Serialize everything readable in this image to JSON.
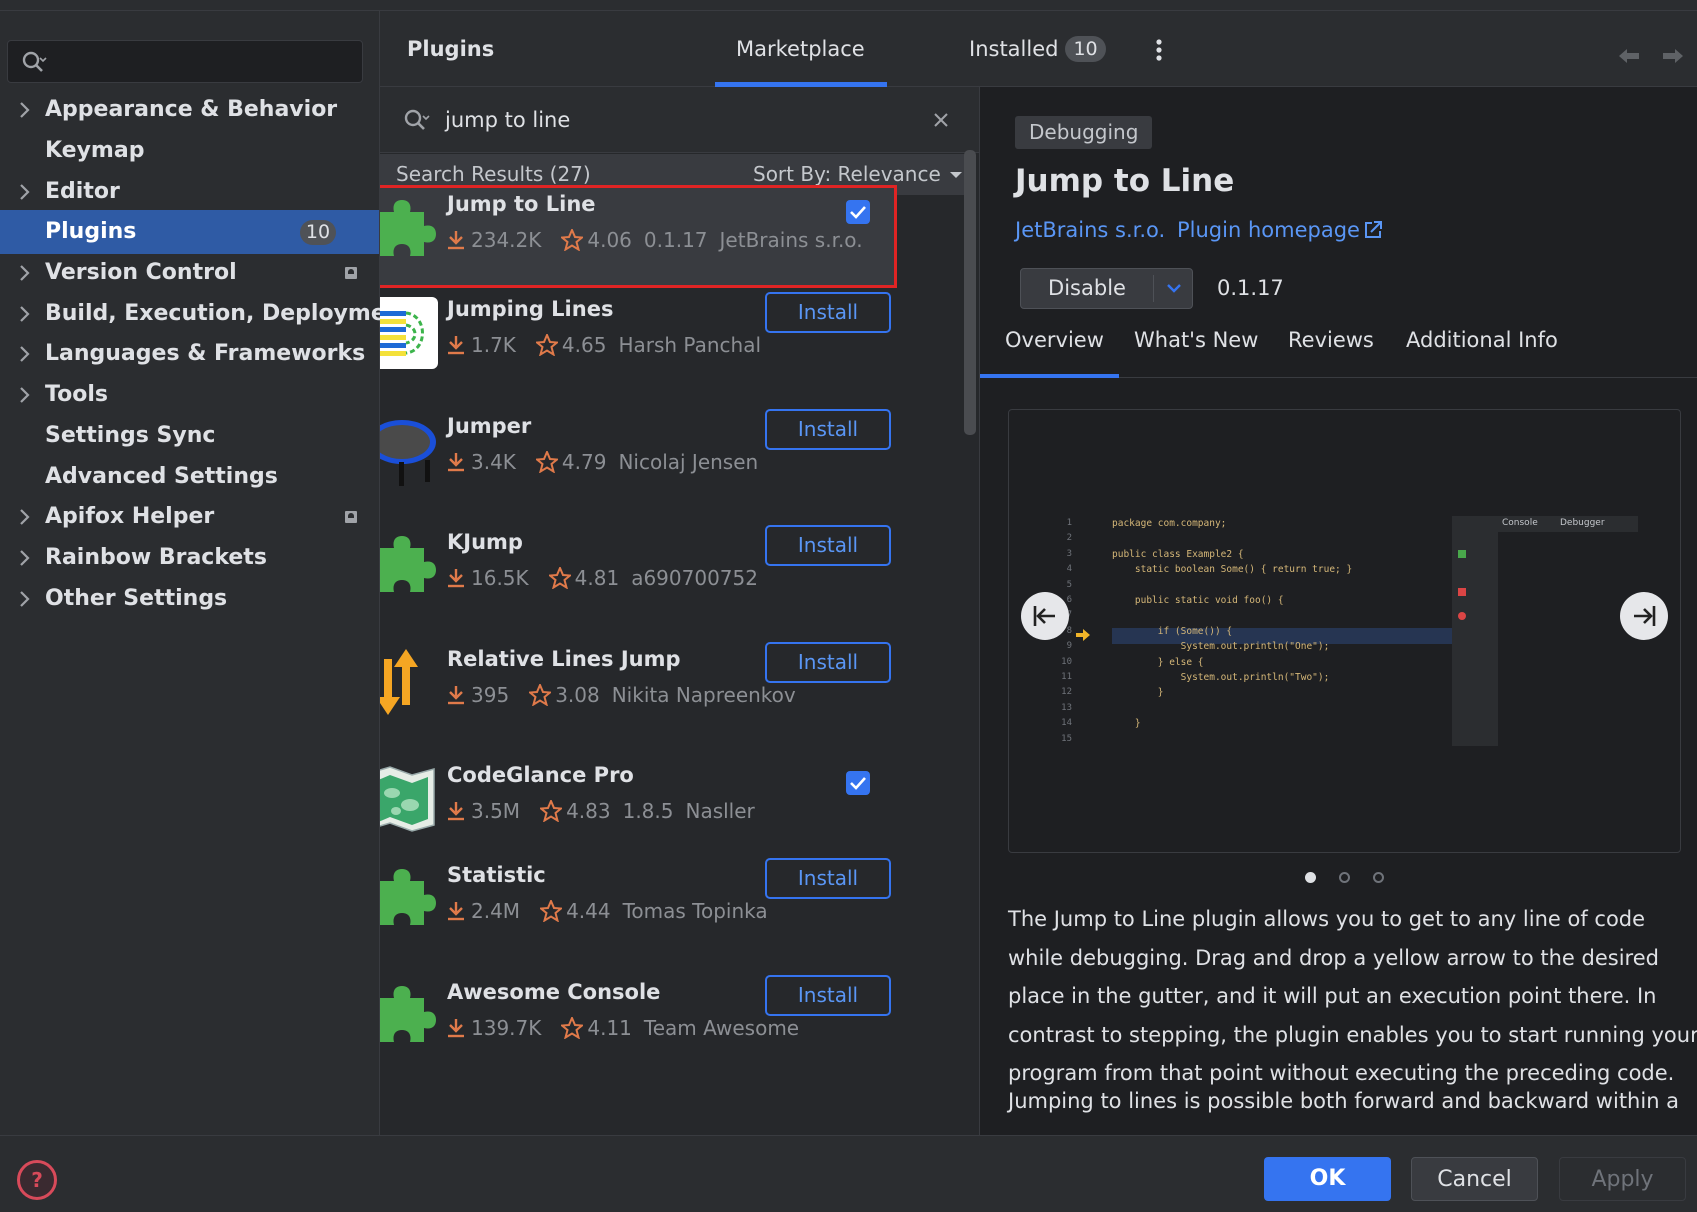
{
  "sidebar": {
    "search_placeholder": "",
    "items": [
      {
        "label": "Appearance & Behavior",
        "expandable": true
      },
      {
        "label": "Keymap",
        "expandable": false
      },
      {
        "label": "Editor",
        "expandable": true
      },
      {
        "label": "Plugins",
        "expandable": false,
        "badge": "10",
        "selected": true
      },
      {
        "label": "Version Control",
        "expandable": true,
        "marker": true
      },
      {
        "label": "Build, Execution, Deployment",
        "expandable": true
      },
      {
        "label": "Languages & Frameworks",
        "expandable": true
      },
      {
        "label": "Tools",
        "expandable": true
      },
      {
        "label": "Settings Sync",
        "expandable": false
      },
      {
        "label": "Advanced Settings",
        "expandable": false
      },
      {
        "label": "Apifox Helper",
        "expandable": true,
        "marker": true
      },
      {
        "label": "Rainbow Brackets",
        "expandable": true
      },
      {
        "label": "Other Settings",
        "expandable": true
      }
    ]
  },
  "header": {
    "title": "Plugins",
    "tab_marketplace": "Marketplace",
    "tab_installed": "Installed",
    "installed_count": "10"
  },
  "search": {
    "query": "jump to line",
    "results_label": "Search Results (27)",
    "sort_label": "Sort By: Relevance"
  },
  "plugins": [
    {
      "name": "Jump to Line",
      "downloads": "234.2K",
      "rating": "4.06",
      "version": "0.1.17",
      "vendor": "JetBrains s.r.o.",
      "state": "installed",
      "icon": "puzzle-icon",
      "highlighted": true
    },
    {
      "name": "Jumping Lines",
      "downloads": "1.7K",
      "rating": "4.65",
      "version": "",
      "vendor": "Harsh Panchal",
      "state": "install",
      "icon": "jumping-lines-icon"
    },
    {
      "name": "Jumper",
      "downloads": "3.4K",
      "rating": "4.79",
      "version": "",
      "vendor": "Nicolaj Jensen",
      "state": "install",
      "icon": "trampoline-icon"
    },
    {
      "name": "KJump",
      "downloads": "16.5K",
      "rating": "4.81",
      "version": "",
      "vendor": "a690700752",
      "state": "install",
      "icon": "puzzle-icon"
    },
    {
      "name": "Relative Lines Jump",
      "downloads": "395",
      "rating": "3.08",
      "version": "",
      "vendor": "Nikita Napreenkov",
      "state": "install",
      "icon": "up-down-arrows-icon"
    },
    {
      "name": "CodeGlance Pro",
      "downloads": "3.5M",
      "rating": "4.83",
      "version": "1.8.5",
      "vendor": "Nasller",
      "state": "installed",
      "icon": "map-icon"
    },
    {
      "name": "Statistic",
      "downloads": "2.4M",
      "rating": "4.44",
      "version": "",
      "vendor": "Tomas Topinka",
      "state": "install",
      "icon": "puzzle-icon"
    },
    {
      "name": "Awesome Console",
      "downloads": "139.7K",
      "rating": "4.11",
      "version": "",
      "vendor": "Team Awesome",
      "state": "install",
      "icon": "puzzle-icon"
    }
  ],
  "install_label": "Install",
  "detail": {
    "category": "Debugging",
    "title": "Jump to Line",
    "vendor_link": "JetBrains s.r.o.",
    "homepage_link": "Plugin homepage",
    "disable_label": "Disable",
    "version": "0.1.17",
    "tabs": [
      "Overview",
      "What's New",
      "Reviews",
      "Additional Info"
    ],
    "active_tab": "Overview",
    "description": [
      "The Jump to Line plugin allows you to get to any line of code",
      "while debugging. Drag and drop a yellow arrow to the desired",
      "place in the gutter, and it will put an execution point there. In",
      "contrast to stepping, the plugin enables you to start running your",
      "program from that point without executing the preceding code."
    ],
    "description2": "Jumping to lines is possible both forward and backward within a",
    "carousel_dots": 3,
    "carousel_active": 0,
    "screenshot": {
      "line_numbers": [
        "1",
        "2",
        "3",
        "4",
        "5",
        "6",
        "7",
        "8",
        "9",
        "10",
        "11",
        "12",
        "13",
        "14",
        "15"
      ],
      "code": [
        "package com.company;",
        "",
        "public class Example2 {",
        "    static boolean Some() { return true; }",
        "",
        "    public static void foo() {",
        "",
        "        if (Some()) {",
        "            System.out.println(\"One\");",
        "        } else {",
        "            System.out.println(\"Two\");",
        "        }",
        "",
        "    }",
        ""
      ],
      "tab_console": "Console",
      "tab_debugger": "Debugger"
    }
  },
  "footer": {
    "ok": "OK",
    "cancel": "Cancel",
    "apply": "Apply"
  },
  "colors": {
    "accent": "#3574f0",
    "selection": "#2f5ba5",
    "link": "#5a96f5",
    "highlight_border": "#e02424",
    "rating": "#e07a4a",
    "puzzle": "#4cb04f"
  }
}
